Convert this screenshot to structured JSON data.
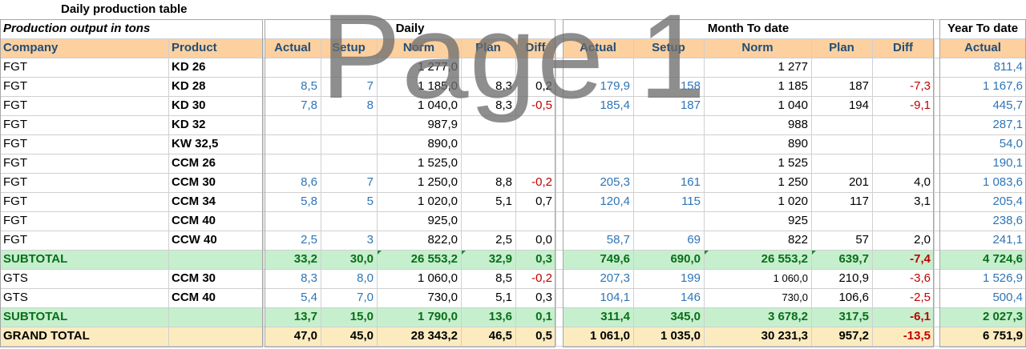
{
  "title": "Daily production table",
  "subtitle": "Production output in tons",
  "groups": {
    "daily": "Daily",
    "mtd": "Month To date",
    "ytd": "Year To date"
  },
  "columns": {
    "company": "Company",
    "product": "Product",
    "d_actual": "Actual",
    "d_setup": "Setup",
    "d_norm": "Norm",
    "d_plan": "Plan",
    "d_diff": "Diff",
    "m_actual": "Actual",
    "m_setup": "Setup",
    "m_norm": "Norm",
    "m_plan": "Plan",
    "m_diff": "Diff",
    "y_actual": "Actual"
  },
  "rows": [
    {
      "company": "FGT",
      "product": "KD 26",
      "d_actual": "",
      "d_setup": "",
      "d_norm": "1 277,0",
      "d_plan": "",
      "d_diff": "",
      "m_actual": "",
      "m_setup": "",
      "m_norm": "1 277",
      "m_plan": "",
      "m_diff": "",
      "y_actual": "811,4"
    },
    {
      "company": "FGT",
      "product": "KD 28",
      "d_actual": "8,5",
      "d_setup": "7",
      "d_norm": "1 185,0",
      "d_plan": "8,3",
      "d_diff": "0,2",
      "m_actual": "179,9",
      "m_setup": "158",
      "m_norm": "1 185",
      "m_plan": "187",
      "m_diff": "-7,3",
      "y_actual": "1 167,6"
    },
    {
      "company": "FGT",
      "product": "KD 30",
      "d_actual": "7,8",
      "d_setup": "8",
      "d_norm": "1 040,0",
      "d_plan": "8,3",
      "d_diff": "-0,5",
      "m_actual": "185,4",
      "m_setup": "187",
      "m_norm": "1 040",
      "m_plan": "194",
      "m_diff": "-9,1",
      "y_actual": "445,7"
    },
    {
      "company": "FGT",
      "product": "KD 32",
      "d_actual": "",
      "d_setup": "",
      "d_norm": "987,9",
      "d_plan": "",
      "d_diff": "",
      "m_actual": "",
      "m_setup": "",
      "m_norm": "988",
      "m_plan": "",
      "m_diff": "",
      "y_actual": "287,1"
    },
    {
      "company": "FGT",
      "product": "KW 32,5",
      "d_actual": "",
      "d_setup": "",
      "d_norm": "890,0",
      "d_plan": "",
      "d_diff": "",
      "m_actual": "",
      "m_setup": "",
      "m_norm": "890",
      "m_plan": "",
      "m_diff": "",
      "y_actual": "54,0"
    },
    {
      "company": "FGT",
      "product": "CCM 26",
      "d_actual": "",
      "d_setup": "",
      "d_norm": "1 525,0",
      "d_plan": "",
      "d_diff": "",
      "m_actual": "",
      "m_setup": "",
      "m_norm": "1 525",
      "m_plan": "",
      "m_diff": "",
      "y_actual": "190,1"
    },
    {
      "company": "FGT",
      "product": "CCM 30",
      "d_actual": "8,6",
      "d_setup": "7",
      "d_norm": "1 250,0",
      "d_plan": "8,8",
      "d_diff": "-0,2",
      "m_actual": "205,3",
      "m_setup": "161",
      "m_norm": "1 250",
      "m_plan": "201",
      "m_diff": "4,0",
      "y_actual": "1 083,6"
    },
    {
      "company": "FGT",
      "product": "CCM 34",
      "d_actual": "5,8",
      "d_setup": "5",
      "d_norm": "1 020,0",
      "d_plan": "5,1",
      "d_diff": "0,7",
      "m_actual": "120,4",
      "m_setup": "115",
      "m_norm": "1 020",
      "m_plan": "117",
      "m_diff": "3,1",
      "y_actual": "205,4"
    },
    {
      "company": "FGT",
      "product": "CCM 40",
      "d_actual": "",
      "d_setup": "",
      "d_norm": "925,0",
      "d_plan": "",
      "d_diff": "",
      "m_actual": "",
      "m_setup": "",
      "m_norm": "925",
      "m_plan": "",
      "m_diff": "",
      "y_actual": "238,6"
    },
    {
      "company": "FGT",
      "product": "CCW 40",
      "d_actual": "2,5",
      "d_setup": "3",
      "d_norm": "822,0",
      "d_plan": "2,5",
      "d_diff": "0,0",
      "m_actual": "58,7",
      "m_setup": "69",
      "m_norm": "822",
      "m_plan": "57",
      "m_diff": "2,0",
      "y_actual": "241,1"
    }
  ],
  "subtotal1": {
    "label": "SUBTOTAL",
    "d_actual": "33,2",
    "d_setup": "30,0",
    "d_norm": "26 553,2",
    "d_plan": "32,9",
    "d_diff": "0,3",
    "m_actual": "749,6",
    "m_setup": "690,0",
    "m_norm": "26 553,2",
    "m_plan": "639,7",
    "m_diff": "-7,4",
    "y_actual": "4 724,6"
  },
  "rows2": [
    {
      "company": "GTS",
      "product": "CCM 30",
      "d_actual": "8,3",
      "d_setup": "8,0",
      "d_norm": "1 060,0",
      "d_plan": "8,5",
      "d_diff": "-0,2",
      "m_actual": "207,3",
      "m_setup": "199",
      "m_norm": "1 060,0",
      "m_plan": "210,9",
      "m_diff": "-3,6",
      "y_actual": "1 526,9"
    },
    {
      "company": "GTS",
      "product": "CCM 40",
      "d_actual": "5,4",
      "d_setup": "7,0",
      "d_norm": "730,0",
      "d_plan": "5,1",
      "d_diff": "0,3",
      "m_actual": "104,1",
      "m_setup": "146",
      "m_norm": "730,0",
      "m_plan": "106,6",
      "m_diff": "-2,5",
      "y_actual": "500,4"
    }
  ],
  "subtotal2": {
    "label": "SUBTOTAL",
    "d_actual": "13,7",
    "d_setup": "15,0",
    "d_norm": "1 790,0",
    "d_plan": "13,6",
    "d_diff": "0,1",
    "m_actual": "311,4",
    "m_setup": "345,0",
    "m_norm": "3 678,2",
    "m_plan": "317,5",
    "m_diff": "-6,1",
    "y_actual": "2 027,3"
  },
  "grand_total": {
    "label": "GRAND TOTAL",
    "d_actual": "47,0",
    "d_setup": "45,0",
    "d_norm": "28 343,2",
    "d_plan": "46,5",
    "d_diff": "0,5",
    "m_actual": "1 061,0",
    "m_setup": "1 035,0",
    "m_norm": "30 231,3",
    "m_plan": "957,2",
    "m_diff": "-13,5",
    "y_actual": "6 751,9"
  },
  "watermark": "Page 1",
  "colors": {
    "header_fill": "#fdd09f",
    "subtotal_fill": "#c6efce",
    "grand_total_fill": "#fdebc0",
    "value_blue": "#2e75b6",
    "negative_red": "#c00000",
    "subtotal_green": "#0a6e1a"
  }
}
